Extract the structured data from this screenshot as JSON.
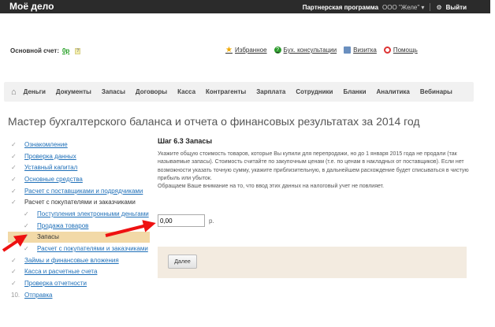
{
  "topbar": {
    "logo": "Моё дело",
    "partner": "Партнерская программа",
    "org": "ООО \"Желе\" ▾",
    "logout": "Выйти"
  },
  "account": {
    "label": "Основной счет:",
    "balance": "0р",
    "help": "?"
  },
  "links": [
    {
      "label": "Избранное",
      "icon": "star-icon"
    },
    {
      "label": "Бух. консультации",
      "icon": "question-icon"
    },
    {
      "label": "Визитка",
      "icon": "card-icon"
    },
    {
      "label": "Помощь",
      "icon": "lifebuoy-icon"
    }
  ],
  "nav": [
    "Деньги",
    "Документы",
    "Запасы",
    "Договоры",
    "Касса",
    "Контрагенты",
    "Зарплата",
    "Сотрудники",
    "Бланки",
    "Аналитика",
    "Вебинары"
  ],
  "title": "Мастер бухгалтерского баланса и отчета о финансовых результатах за 2014 год",
  "steps": [
    {
      "label": "Ознакомление",
      "link": true,
      "sub": false
    },
    {
      "label": "Проверка данных",
      "link": true,
      "sub": false
    },
    {
      "label": "Уставный капитал",
      "link": true,
      "sub": false
    },
    {
      "label": "Основные средства",
      "link": true,
      "sub": false
    },
    {
      "label": "Расчет с поставщиками и подрядчиками",
      "link": true,
      "sub": false
    },
    {
      "label": "Расчет с покупателями и заказчиками",
      "link": false,
      "sub": false
    },
    {
      "label": "Поступления электронными деньгами",
      "link": true,
      "sub": true
    },
    {
      "label": "Продажа товаров",
      "link": true,
      "sub": true
    },
    {
      "label": "Запасы",
      "link": false,
      "sub": true,
      "active": true
    },
    {
      "label": "Расчет с покупателями и заказчиками",
      "link": true,
      "sub": true
    },
    {
      "label": "Займы и финансовые вложения",
      "link": true,
      "sub": false
    },
    {
      "label": "Касса и расчетные счета",
      "link": true,
      "sub": false
    },
    {
      "label": "Проверка отчетности",
      "link": true,
      "sub": false
    },
    {
      "label": "Отправка",
      "link": true,
      "sub": false,
      "num": "10."
    }
  ],
  "content": {
    "heading": "Шаг 6.3 Запасы",
    "text": "Укажите общую стоимость товаров, которые Вы купили для перепродажи, но до 1 января 2015 года не продали (так называемые запасы). Стоимость считайте по закупочным ценам (т.е. по ценам в накладных от поставщиков). Если нет возможности указать точную сумму, укажите приблизительную, в дальнейшем расхождение будет списываться в чистую прибыль или убыток.",
    "note": "Обращаем Ваше внимание на то, что ввод этих данных на налоговый учет не повлияет.",
    "amount": "0,00",
    "currency": "р.",
    "next": "Далее"
  }
}
